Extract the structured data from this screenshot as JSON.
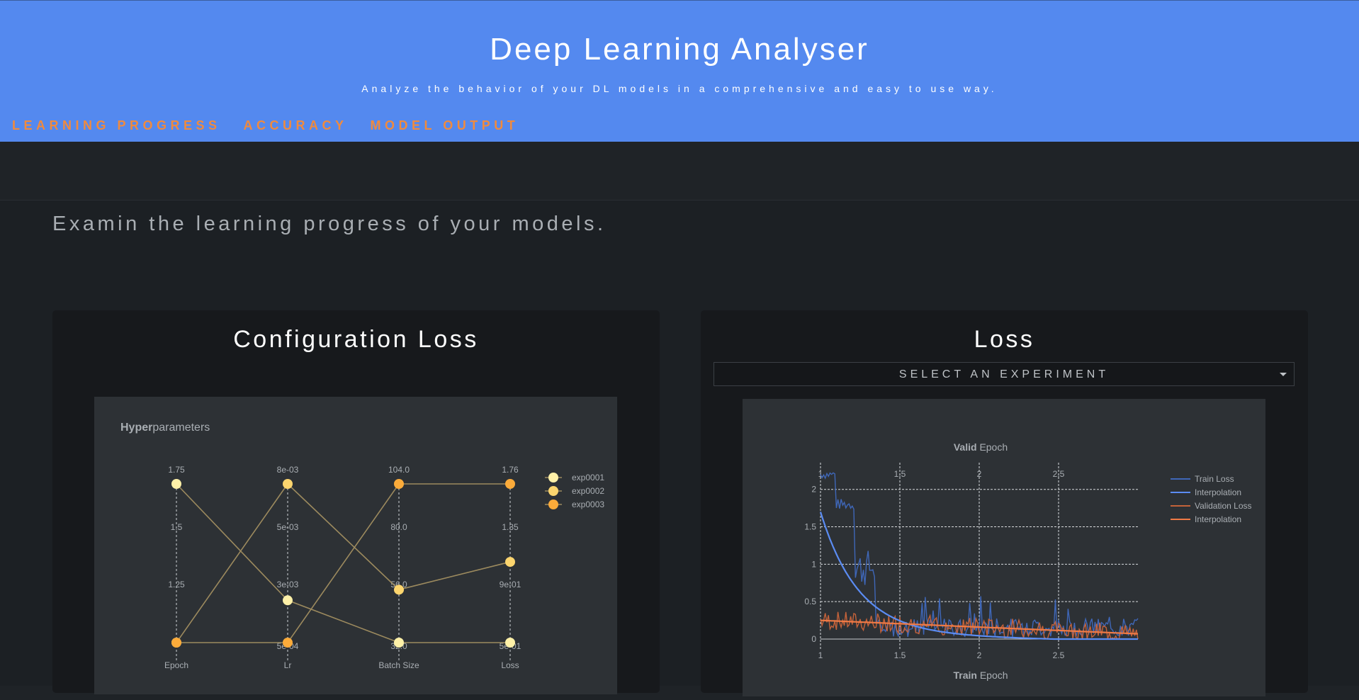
{
  "header": {
    "title": "Deep Learning Analyser",
    "subtitle": "Analyze the behavior of your DL models in a comprehensive and easy to use way.",
    "background": "#5489ef",
    "nav_color": "#f08a3e"
  },
  "nav": {
    "items": [
      {
        "label": "LEARNING PROGRESS"
      },
      {
        "label": "ACCURACY"
      },
      {
        "label": "MODEL OUTPUT"
      }
    ]
  },
  "intro": "Examin the learning progress of your models.",
  "config_card": {
    "title": "Configuration Loss",
    "panel_title_bold": "Hyper",
    "panel_title_rest": "parameters"
  },
  "loss_card": {
    "title": "Loss",
    "select_placeholder": "SELECT AN EXPERIMENT"
  },
  "chart_data": [
    {
      "type": "parallel-coordinates",
      "title_bold": "Hyper",
      "title_rest": "parameters",
      "axes": [
        {
          "name": "Epoch",
          "min": 1,
          "max": 1.75,
          "ticks": [
            "1.75",
            "1.5",
            "1.25"
          ],
          "min_label": ""
        },
        {
          "name": "Lr",
          "min": 0.0005,
          "max": 0.008,
          "ticks": [
            "8e-03",
            "5e-03",
            "3e-03"
          ],
          "min_label": "5e-04"
        },
        {
          "name": "Batch Size",
          "min": 32,
          "max": 104,
          "ticks": [
            "104.0",
            "80.0",
            "56.0"
          ],
          "min_label": "32.0"
        },
        {
          "name": "Loss",
          "min": 0.01,
          "max": 1.76,
          "ticks": [
            "1.76",
            "1.35",
            "9e-01"
          ],
          "min_label": "5e-01"
        }
      ],
      "series": [
        {
          "name": "exp0001",
          "color": "#fff1a8",
          "values": [
            1.75,
            0.0025,
            32,
            0.01
          ]
        },
        {
          "name": "exp0002",
          "color": "#fcd56e",
          "values": [
            1,
            0.008,
            56,
            0.9
          ]
        },
        {
          "name": "exp0003",
          "color": "#fbab3a",
          "values": [
            1,
            0.0005,
            104,
            1.76
          ]
        }
      ]
    },
    {
      "type": "line",
      "title_bold": "Valid",
      "title_rest": "Epoch",
      "xlabel_bold": "Train",
      "xlabel_rest": "Epoch",
      "xlim": [
        1,
        3
      ],
      "ylim": [
        0,
        2.3
      ],
      "x_ticks": [
        "1",
        "1.5",
        "2",
        "2.5"
      ],
      "y_ticks": [
        "0",
        "0.5",
        "1",
        "1.5",
        "2"
      ],
      "grid": true,
      "legend_position": "right",
      "series": [
        {
          "name": "Train Loss",
          "color": "#3f67b8",
          "kind": "noisy-train"
        },
        {
          "name": "Interpolation",
          "color": "#5b8cf3",
          "kind": "decay-train"
        },
        {
          "name": "Validation Loss",
          "color": "#c4623a",
          "kind": "noisy-valid"
        },
        {
          "name": "Interpolation",
          "color": "#f07a45",
          "kind": "decay-valid"
        }
      ]
    }
  ]
}
